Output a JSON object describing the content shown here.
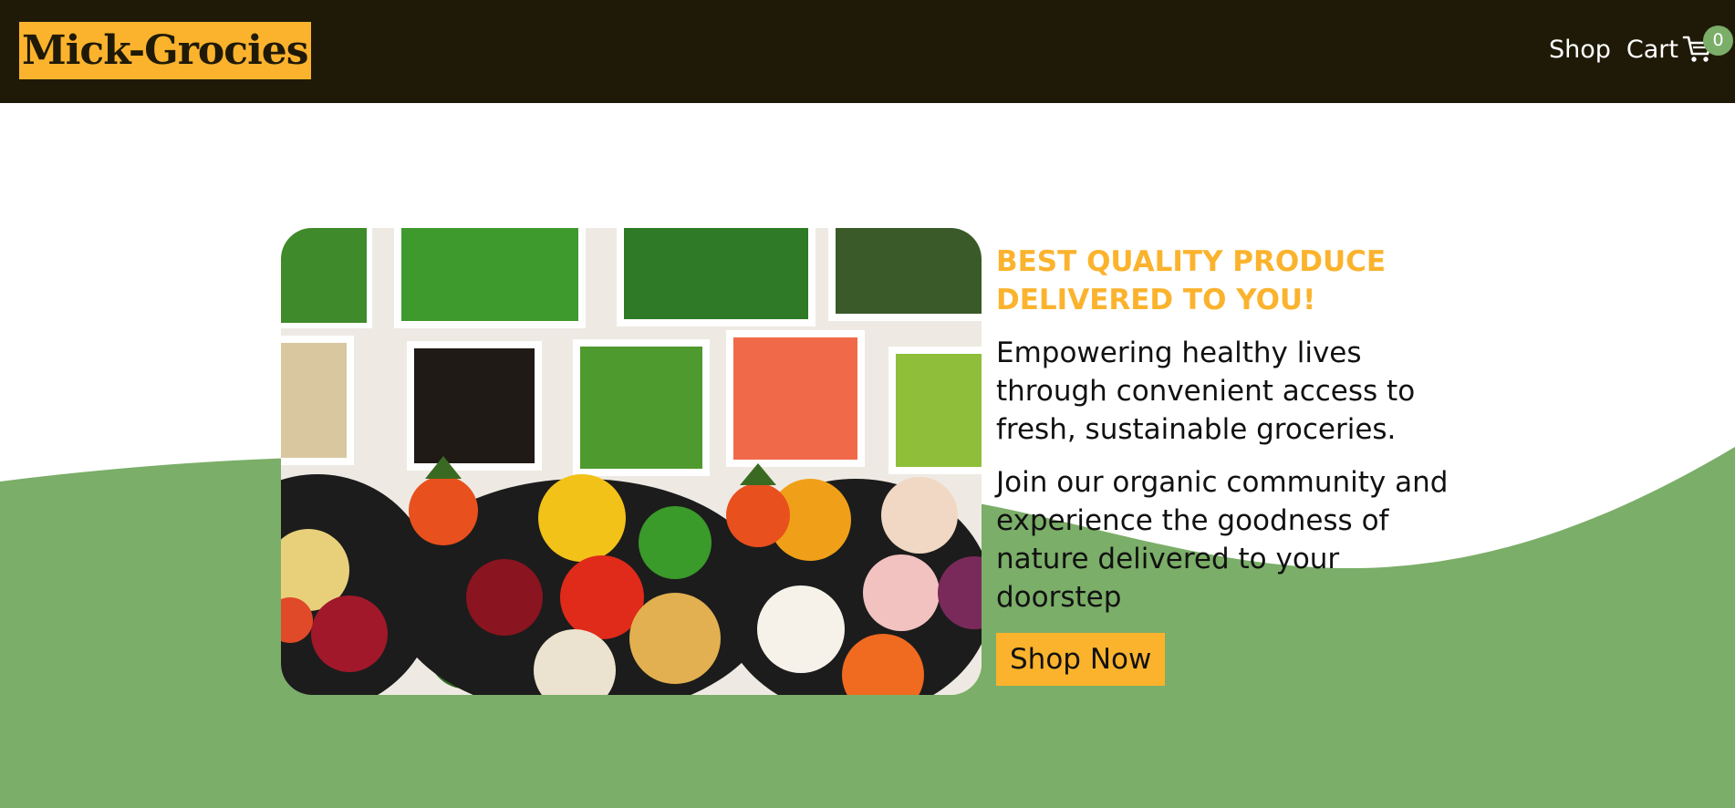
{
  "header": {
    "logo": "Mick-Grocies",
    "nav": {
      "shop": "Shop",
      "cart": "Cart",
      "cart_count": "0"
    }
  },
  "hero": {
    "title": "BEST QUALITY PRODUCE DELIVERED TO YOU!",
    "paragraph_1": "Empowering healthy lives through convenient access to fresh, sustainable groceries.",
    "paragraph_2": "Join our organic community and experience the goodness of nature delivered to your doorstep",
    "cta": "Shop Now",
    "image_icon": "produce-photo"
  },
  "colors": {
    "navbar_bg": "#1f1a08",
    "accent": "#fbb32d",
    "green": "#7bae68",
    "text": "#111111"
  }
}
